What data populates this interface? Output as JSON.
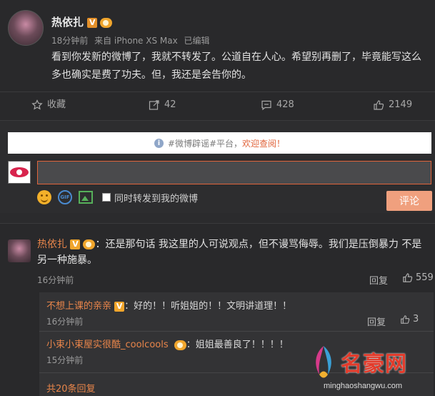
{
  "post": {
    "author": "热依扎",
    "v_badge": "V",
    "time": "18分钟前",
    "source": "来自 iPhone XS Max",
    "edited": "已编辑",
    "text": "看到你发新的微博了，我就不转发了。公道自在人心。希望别再删了，毕竟能写这么多也确实是费了功夫。但，我还是会告你的。",
    "actions": {
      "favorite": "收藏",
      "repost_count": "42",
      "comment_count": "428",
      "like_count": "2149"
    }
  },
  "comment_box": {
    "notice_prefix": "#微博辟谣#平台，",
    "notice_highlight": "欢迎查阅！",
    "input_value": "",
    "also_repost_label": "同时转发到我的微博",
    "submit_label": "评论",
    "gif_label": "GIF"
  },
  "comment": {
    "author": "热依扎",
    "v_badge": "V",
    "text": "：还是那句话 我这里的人可说观点，但不谩骂侮辱。我们是压倒暴力 不是另一种施暴。",
    "time": "16分钟前",
    "reply_label": "回复",
    "like_count": "559",
    "replies": [
      {
        "author": "不想上课的亲亲",
        "v_badge": "V",
        "text": "：好的！！听姐姐的！！文明讲道理！！",
        "time": "16分钟前",
        "reply_label": "回复",
        "like_count": "3"
      },
      {
        "author": "小束小束屋实很酷_coolcools",
        "text": "：姐姐最善良了！！！！",
        "time": "15分钟前"
      }
    ],
    "more_replies": "共20条回复"
  },
  "watermark": {
    "title": "名豪网",
    "url": "minghaoshangwu.com"
  },
  "colors": {
    "accent": "#e8854a",
    "highlight": "#e0643b",
    "background": "#2b2b2d"
  }
}
